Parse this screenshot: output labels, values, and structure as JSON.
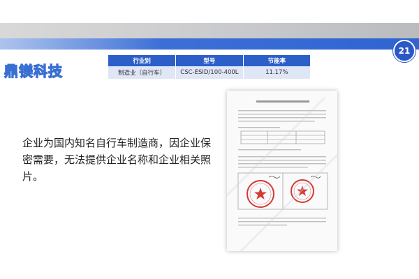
{
  "header": {
    "page_number": "21"
  },
  "brand": {
    "logo_text": "鼎镁科技"
  },
  "table": {
    "headers": [
      "行业别",
      "型号",
      "节能率"
    ],
    "rows": [
      [
        "制造业（自行车）",
        "CSC-ESID/100-400L",
        "11.17%"
      ]
    ]
  },
  "main": {
    "description": "企业为国内知名自行车制造商，因企业保密需要，无法提供企业名称和企业相关照片。"
  },
  "colors": {
    "accent_blue": "#2d5fc9",
    "table_row_bg": "#dfe7f6",
    "stamp_red": "#d23a33"
  }
}
